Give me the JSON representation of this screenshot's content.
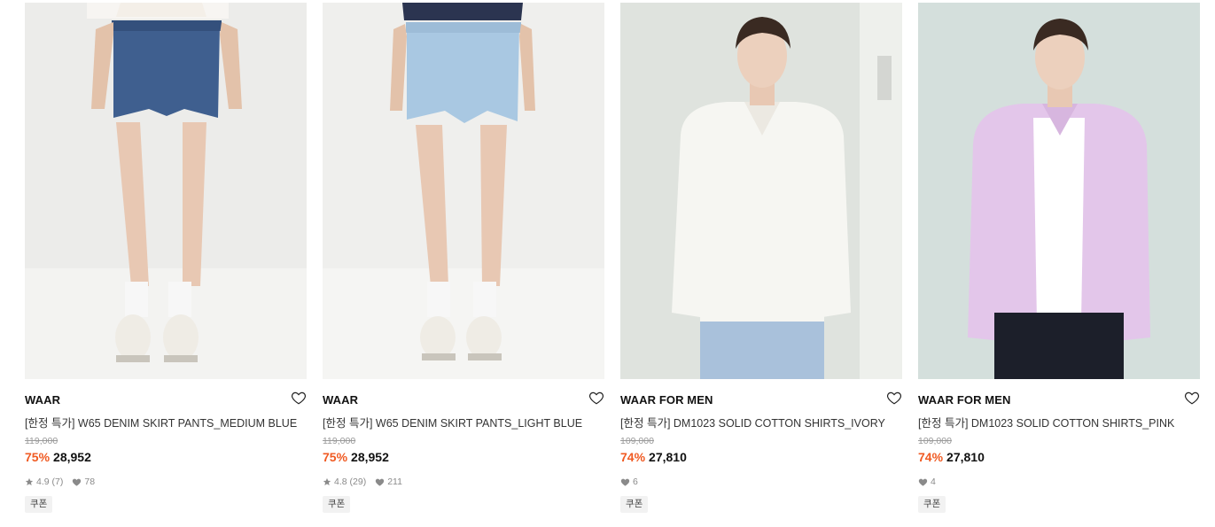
{
  "products": [
    {
      "brand": "WAAR",
      "title": "[한정 특가] W65 DENIM SKIRT PANTS_MEDIUM BLUE",
      "original_price": "119,000",
      "discount": "75%",
      "price": "28,952",
      "rating": "4.9",
      "review_count": "(7)",
      "likes": "78",
      "coupon": "쿠폰",
      "photo_color": "#3f5f8f"
    },
    {
      "brand": "WAAR",
      "title": "[한정 특가] W65 DENIM SKIRT PANTS_LIGHT BLUE",
      "original_price": "119,000",
      "discount": "75%",
      "price": "28,952",
      "rating": "4.8",
      "review_count": "(29)",
      "likes": "211",
      "coupon": "쿠폰",
      "photo_color": "#a9c8e2"
    },
    {
      "brand": "WAAR FOR MEN",
      "title": "[한정 특가] DM1023 SOLID COTTON SHIRTS_IVORY",
      "original_price": "109,000",
      "discount": "74%",
      "price": "27,810",
      "likes": "6",
      "coupon": "쿠폰",
      "photo_color": "#f6f6f2"
    },
    {
      "brand": "WAAR FOR MEN",
      "title": "[한정 특가] DM1023 SOLID COTTON SHIRTS_PINK",
      "original_price": "109,000",
      "discount": "74%",
      "price": "27,810",
      "likes": "4",
      "coupon": "쿠폰",
      "photo_color": "#e3c6ea"
    }
  ],
  "colors": {
    "discount": "#f05a22",
    "text": "#111111",
    "muted": "#9a9a9a"
  },
  "icons": {
    "wishlist": "heart-outline-icon",
    "rating": "star-icon",
    "likes": "heart-filled-icon"
  }
}
